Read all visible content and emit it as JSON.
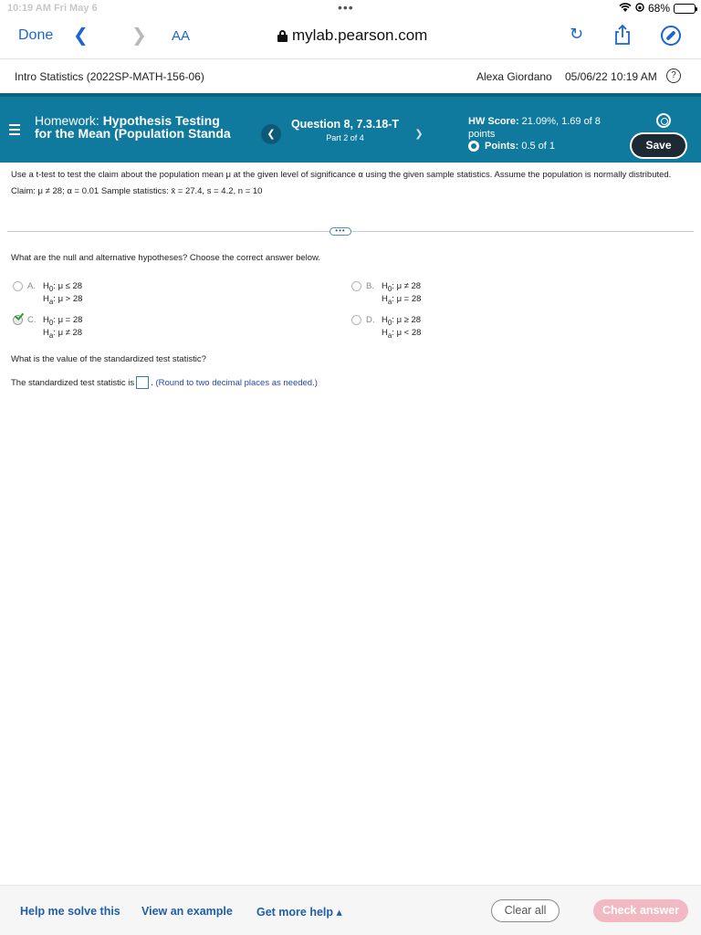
{
  "status_bar": {
    "time": "10:19 AM  Fri May 6",
    "battery": "68%",
    "battery_level": 0.68
  },
  "browser": {
    "done_label": "Done",
    "back_icon": "chevron-left-icon",
    "forward_icon": "chevron-right-icon",
    "text_size_label": "AA",
    "url": "mylab.pearson.com"
  },
  "course_bar": {
    "course": "Intro Statistics (2022SP-MATH-156-06)",
    "user": "Alexa Giordano",
    "datetime": "05/06/22 10:19 AM",
    "help_label": "?"
  },
  "hw_header": {
    "prefix": "Homework: ",
    "title": "Hypothesis Testing for the Mean (Population Standa",
    "question": "Question 8, 7.3.18-T",
    "part": "Part 2 of 4",
    "score_label": "HW Score:",
    "score_value": " 21.09%, 1.69 of 8",
    "score_unit": "points",
    "points_label": "Points:",
    "points_value": " 0.5 of 1",
    "save_label": "Save",
    "accent_color": "#10799e"
  },
  "problem": {
    "text": "Use a t-test to test the claim about the population mean μ at the given level of significance α using the given sample statistics. Assume the population is normally distributed.",
    "claim": "Claim: μ ≠ 28; α = 0.01    Sample statistics: x̄ = 27.4, s = 4.2, n = 10",
    "expander_label": "•••"
  },
  "question1": {
    "prompt": "What are the null and alternative hypotheses? Choose the correct answer below.",
    "options": [
      {
        "letter": "A.",
        "h0": "μ ≤ 28",
        "ha": "μ > 28",
        "selected": false
      },
      {
        "letter": "B.",
        "h0": "μ ≠ 28",
        "ha": "μ = 28",
        "selected": false
      },
      {
        "letter": "C.",
        "h0": "μ = 28",
        "ha": "μ ≠ 28",
        "selected": true
      },
      {
        "letter": "D.",
        "h0": "μ ≥ 28",
        "ha": "μ < 28",
        "selected": false
      }
    ]
  },
  "question2": {
    "prompt": "What is the value of the standardized test statistic?",
    "lead": "The standardized test statistic is ",
    "answer_value": "",
    "hint": ". (Round to two decimal places as needed.)"
  },
  "footer": {
    "help_solve": "Help me solve this",
    "view_example": "View an example",
    "get_help": "Get more help ▴",
    "clear_all": "Clear all",
    "check_answer": "Check answer"
  }
}
